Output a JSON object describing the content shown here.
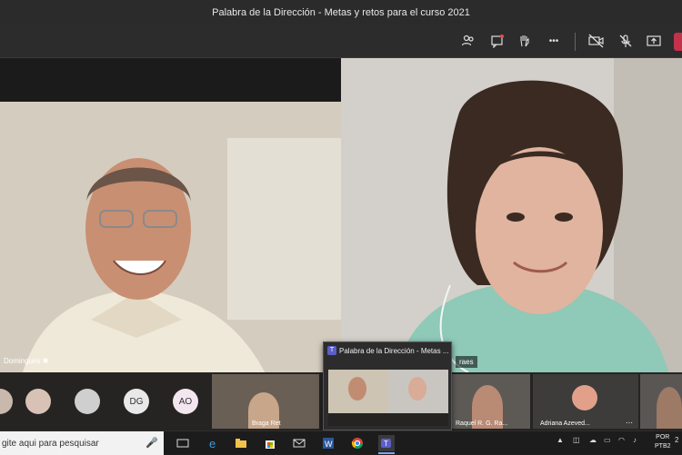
{
  "window": {
    "title": "Palabra de la Dirección - Metas y retos para el curso 2021"
  },
  "toolbar": {
    "icons": [
      "participants-icon",
      "chat-icon",
      "raise-hand-icon",
      "more-icon",
      "camera-off-icon",
      "mic-off-icon",
      "share-icon"
    ],
    "more_glyph": "•••"
  },
  "stage": {
    "left_participant": {
      "name": "Domingues"
    },
    "right_participant": {
      "name": "raes"
    }
  },
  "strip": {
    "avatars": [
      {
        "initials": ""
      },
      {
        "initials": ""
      },
      {
        "initials": "DG"
      },
      {
        "initials": "AO"
      }
    ],
    "thumbs": [
      {
        "name": "Braga Ret"
      },
      {
        "name": "Raquel R. G. Ra..."
      },
      {
        "name": "Adriana Azeved..."
      },
      {
        "name": ""
      }
    ]
  },
  "popup": {
    "title": "Palabra de la Dirección - Metas ..."
  },
  "taskbar": {
    "search_placeholder": "gite aqui para pesquisar",
    "lang_line1": "POR",
    "lang_line2": "PTB2",
    "clock_fragment": "2"
  }
}
